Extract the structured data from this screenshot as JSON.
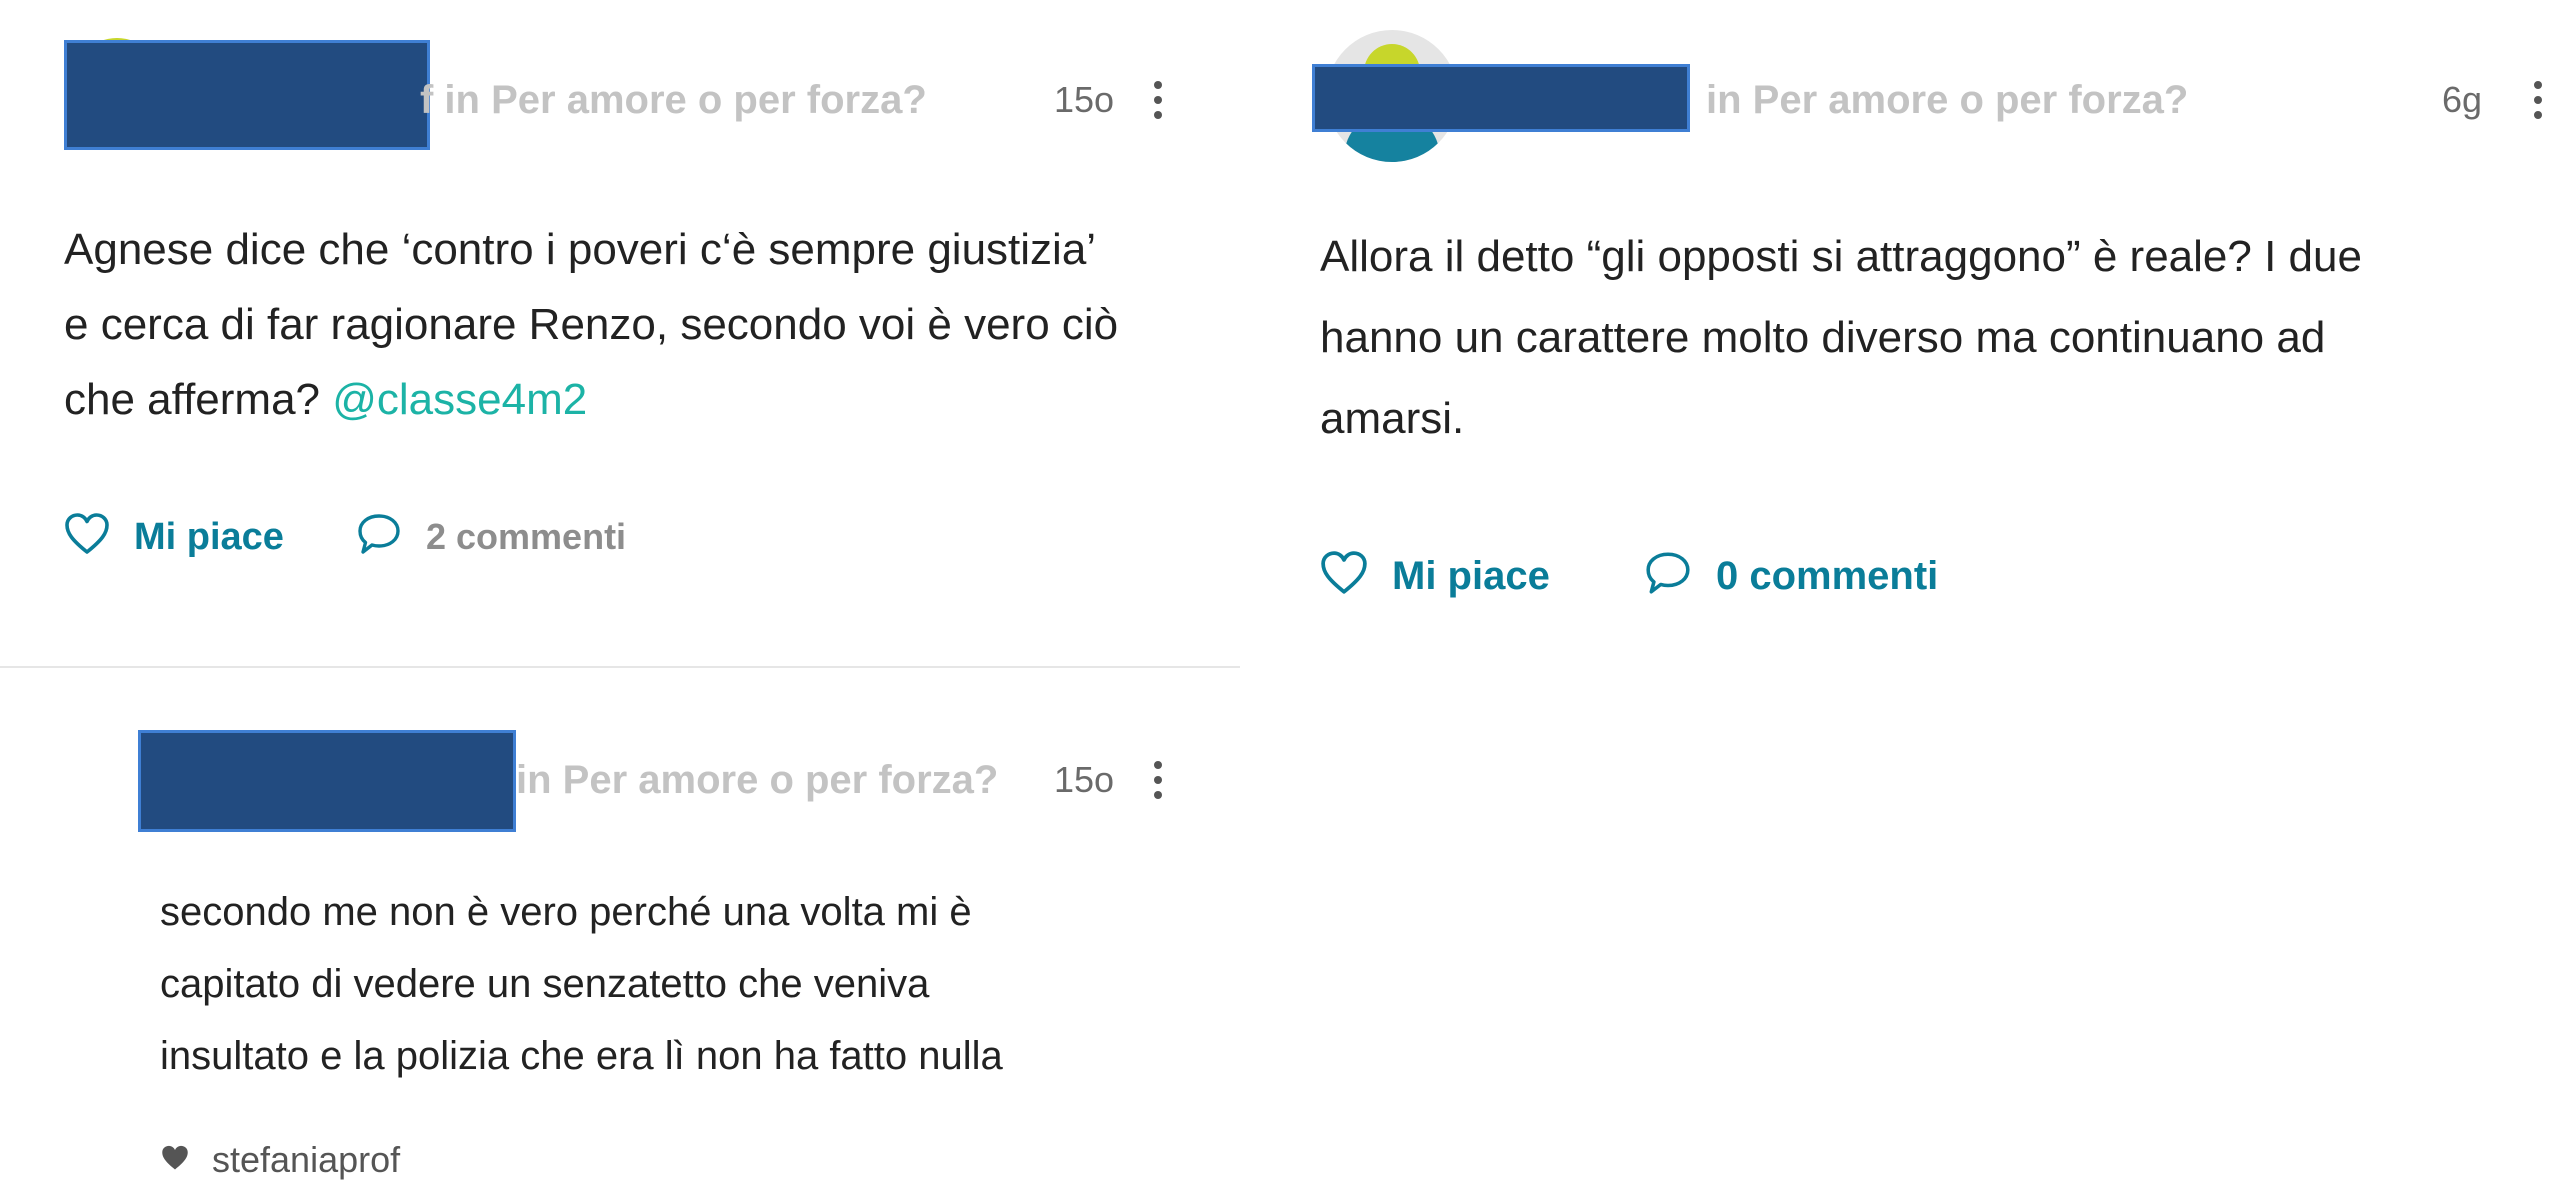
{
  "colors": {
    "accent": "#0a7d99",
    "mention": "#1cb3a6",
    "muted_label": "#c3c3c3",
    "muted_action": "#8d8d8d",
    "text": "#222222",
    "redaction": "#224b80"
  },
  "left_post": {
    "group_label": "f in Per amore o per forza?",
    "timestamp": "15o",
    "body_lines": [
      "Agnese dice che ‘contro i poveri c‘è sempre giustizia’",
      "e cerca di far ragionare Renzo, secondo voi è vero ciò",
      "che afferma? "
    ],
    "mention": "@classe4m2",
    "like_label": "Mi piace",
    "comments_label": "2 commenti",
    "like_icon": "heart-outline-icon",
    "comment_icon": "speech-bubble-icon"
  },
  "reply": {
    "group_label": "in Per amore o per forza?",
    "timestamp": "15o",
    "body_lines": [
      "secondo me non è vero perché una volta mi è",
      "capitato di vedere un senzatetto che veniva",
      "insultato e la polizia che era lì non ha fatto nulla"
    ],
    "liked_by": "stefaniaprof",
    "liked_icon": "heart-filled-icon"
  },
  "right_post": {
    "group_label": "in Per amore o per forza?",
    "timestamp": "6g",
    "body_lines": [
      "Allora il detto “gli opposti si attraggono” è reale? I due",
      "hanno un carattere molto diverso ma continuano ad",
      "amarsi."
    ],
    "like_label": "Mi piace",
    "comments_label": "0 commenti",
    "like_icon": "heart-outline-icon",
    "comment_icon": "speech-bubble-icon"
  }
}
